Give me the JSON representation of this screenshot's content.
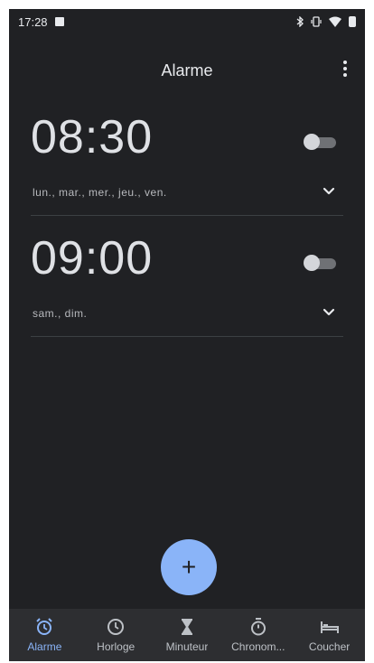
{
  "status_bar": {
    "time": "17:28"
  },
  "header": {
    "title": "Alarme"
  },
  "alarms": [
    {
      "time": "08:30",
      "days": "lun., mar., mer., jeu., ven.",
      "enabled": false
    },
    {
      "time": "09:00",
      "days": "sam., dim.",
      "enabled": false
    }
  ],
  "fab": {
    "label": "+"
  },
  "bottom_nav": {
    "active": "Alarme",
    "items": [
      {
        "label": "Alarme",
        "icon": "alarm-icon"
      },
      {
        "label": "Horloge",
        "icon": "clock-icon"
      },
      {
        "label": "Minuteur",
        "icon": "hourglass-icon"
      },
      {
        "label": "Chronom...",
        "icon": "stopwatch-icon"
      },
      {
        "label": "Coucher",
        "icon": "bed-icon"
      }
    ]
  },
  "colors": {
    "background": "#202124",
    "accent": "#8ab4f8",
    "nav_background": "#2d2e31"
  }
}
